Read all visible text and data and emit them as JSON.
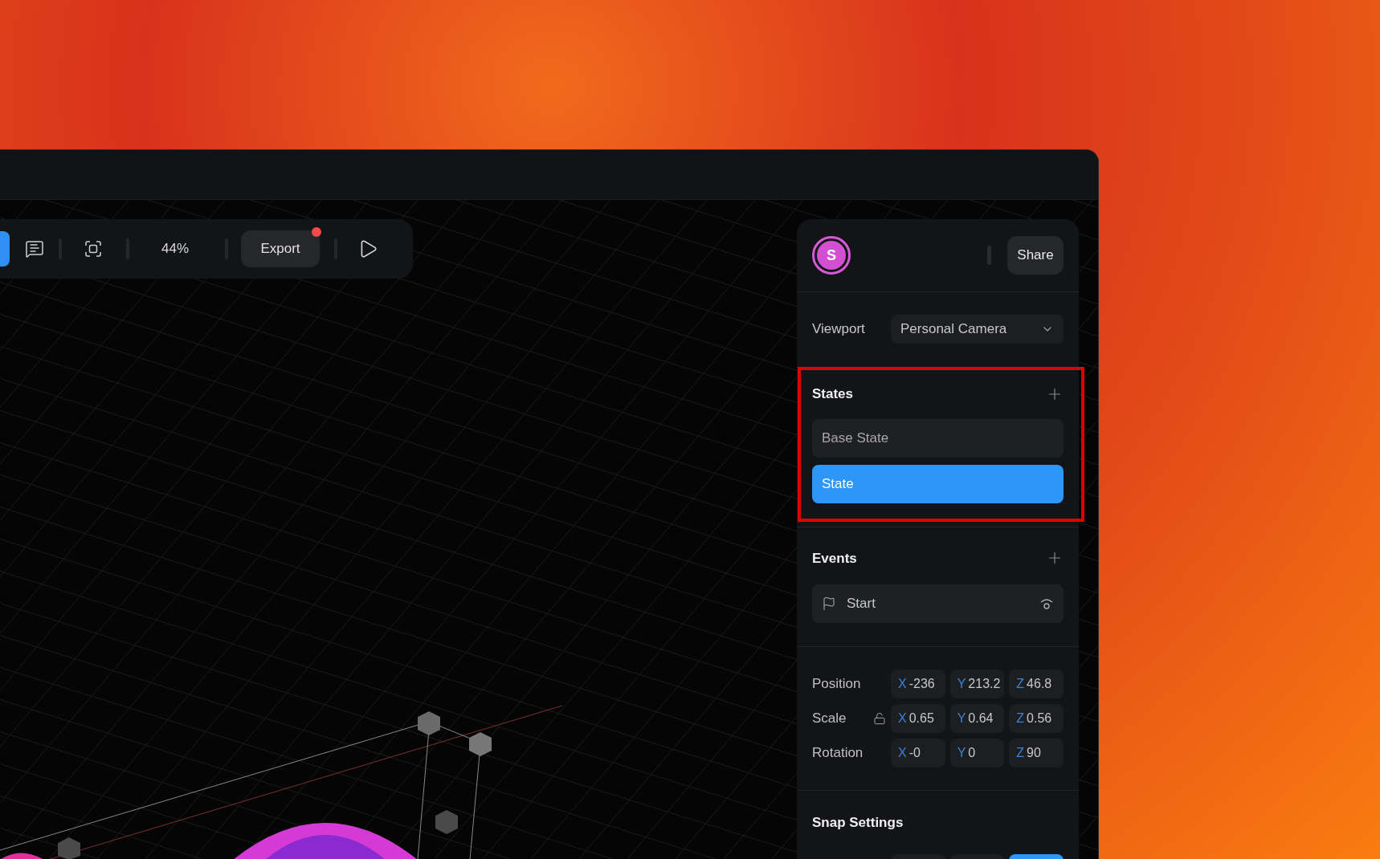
{
  "toolbar": {
    "zoom": "44%",
    "export": {
      "label": "Export",
      "notification": true
    }
  },
  "panel": {
    "avatar": "S",
    "share": "Share",
    "viewport": {
      "label": "Viewport",
      "value": "Personal Camera"
    },
    "states": {
      "title": "States",
      "items": [
        {
          "label": "Base State",
          "selected": false
        },
        {
          "label": "State",
          "selected": true
        }
      ]
    },
    "events": {
      "title": "Events",
      "items": [
        {
          "label": "Start"
        }
      ]
    },
    "transform": [
      {
        "label": "Position",
        "kind": "plain",
        "fields": [
          {
            "axis": "X",
            "value": "-236"
          },
          {
            "axis": "Y",
            "value": "213.2"
          },
          {
            "axis": "Z",
            "value": "46.8"
          }
        ]
      },
      {
        "label": "Scale",
        "kind": "lockable",
        "locked": false,
        "fields": [
          {
            "axis": "X",
            "value": "0.65"
          },
          {
            "axis": "Y",
            "value": "0.64"
          },
          {
            "axis": "Z",
            "value": "0.56"
          }
        ]
      },
      {
        "label": "Rotation",
        "kind": "plain",
        "fields": [
          {
            "axis": "X",
            "value": "-0"
          },
          {
            "axis": "Y",
            "value": "0"
          },
          {
            "axis": "Z",
            "value": "90"
          }
        ]
      }
    ],
    "snap": {
      "title": "Snap Settings",
      "options": [
        {
          "selected": false
        },
        {
          "selected": false
        },
        {
          "selected": true
        }
      ]
    }
  }
}
